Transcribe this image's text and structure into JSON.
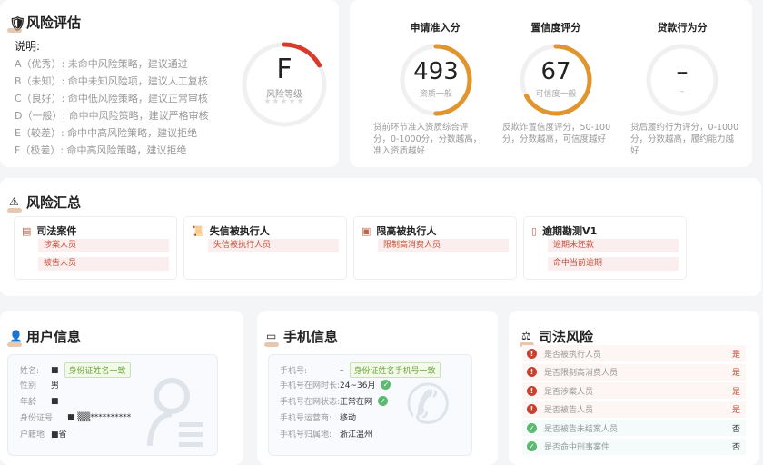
{
  "risk_assessment": {
    "title": "风险评估",
    "legend_title": "说明:",
    "legend": [
      "A（优秀）: 未命中风险策略，建议通过",
      "B（未知）: 命中未知风险项，建议人工复核",
      "C（良好）: 命中低风险策略，建议正常审核",
      "D（一般）: 命中中风险策略，建议严格审核",
      "E（较差）: 命中中高风险策略，建议拒绝",
      "F（极差）: 命中高风险策略，建议拒绝"
    ],
    "grade": "F",
    "grade_label": "风险等级",
    "grade_fraction": 0.17,
    "color": "#d93a2b"
  },
  "scores": [
    {
      "title": "申请准入分",
      "value": "493",
      "label": "资质一般",
      "fraction": 0.5,
      "desc": "贷前环节准入资质综合评分，0-1000分，分数越高，准入资质越好"
    },
    {
      "title": "置信度评分",
      "value": "67",
      "label": "可信度一般",
      "fraction": 0.67,
      "desc": "反欺诈置信度评分，50-100分，分数越高，可信度越好"
    },
    {
      "title": "贷款行为分",
      "value": "–",
      "label": "–",
      "fraction": 0,
      "desc": "贷后履约行为评分，0-1000分，分数越高，履约能力越好"
    }
  ],
  "score_color": "#e0952e",
  "risk_summary": {
    "title": "风险汇总",
    "cards": [
      {
        "title": "司法案件",
        "icon": "judicial-doc-icon",
        "tags": [
          "涉案人员",
          "被告人员"
        ]
      },
      {
        "title": "失信被执行人",
        "icon": "scroll-icon",
        "tags": [
          "失信被执行人员"
        ]
      },
      {
        "title": "限高被执行人",
        "icon": "wallet-icon",
        "tags": [
          "限制高消费人员"
        ]
      },
      {
        "title": "逾期勘测V1",
        "icon": "phone-doc-icon",
        "tags": [
          "逾期未还款",
          "命中当前逾期"
        ]
      }
    ]
  },
  "user_info": {
    "title": "用户信息",
    "rows": [
      {
        "label": "姓名:",
        "value": "■",
        "badge": "身份证姓名一致"
      },
      {
        "label": "性别",
        "value": "男"
      },
      {
        "label": "年龄",
        "value": "■"
      },
      {
        "label": "身份证号",
        "value": "■ ▒▒**********"
      },
      {
        "label": "户籍地",
        "value": "■省"
      }
    ]
  },
  "phone_info": {
    "title": "手机信息",
    "rows": [
      {
        "label": "手机号:",
        "value": "–",
        "badge": "身份证姓名手机号一致"
      },
      {
        "label": "手机号在网时长:",
        "value": "24~36月",
        "ok": true
      },
      {
        "label": "手机号在网状态:",
        "value": "正常在网",
        "ok": true
      },
      {
        "label": "手机号运营商:",
        "value": "移动"
      },
      {
        "label": "手机号归属地:",
        "value": "浙江温州"
      }
    ]
  },
  "judicial_risk": {
    "title": "司法风险",
    "rows": [
      {
        "label": "是否被执行人员",
        "answer": "是",
        "risk": true
      },
      {
        "label": "是否限制高消费人员",
        "answer": "是",
        "risk": true
      },
      {
        "label": "是否涉案人员",
        "answer": "是",
        "risk": true
      },
      {
        "label": "是否被告人员",
        "answer": "是",
        "risk": true
      },
      {
        "label": "是否被告未结案人员",
        "answer": "否",
        "risk": false
      },
      {
        "label": "是否命中刑事案件",
        "answer": "否",
        "risk": false
      }
    ]
  }
}
